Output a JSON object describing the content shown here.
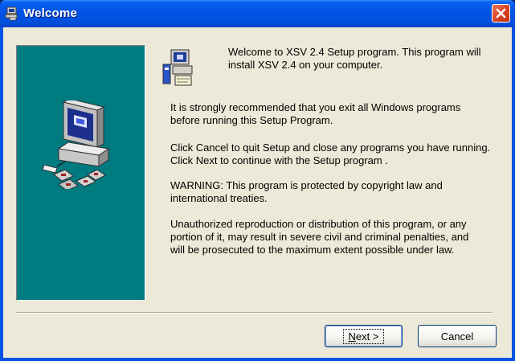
{
  "window": {
    "title": "Welcome"
  },
  "content": {
    "intro": "Welcome to XSV 2.4 Setup program. This program will install XSV 2.4 on your computer.",
    "recommend": "It is strongly recommended that you exit all Windows programs before running this Setup Program.",
    "instructions": "Click Cancel to quit Setup and close any programs you have running.  Click Next to continue with the Setup program .",
    "warning": "WARNING: This program is protected by copyright law and international treaties.",
    "unauthorized": "Unauthorized reproduction or distribution of this program, or any portion of it, may result in severe civil and criminal penalties, and will be prosecuted to the maximum extent possible under law."
  },
  "buttons": {
    "next_mnemonic": "N",
    "next_rest": "ext >",
    "cancel": "Cancel"
  },
  "icons": {
    "title": "setup-app-icon",
    "close": "close-icon",
    "panel": "computer-disks-illustration",
    "setup": "setup-computer-icon"
  },
  "colors": {
    "titlebar": "#0054e3",
    "panel": "#007b80",
    "dialog": "#ece9d8",
    "close": "#d8401f"
  }
}
